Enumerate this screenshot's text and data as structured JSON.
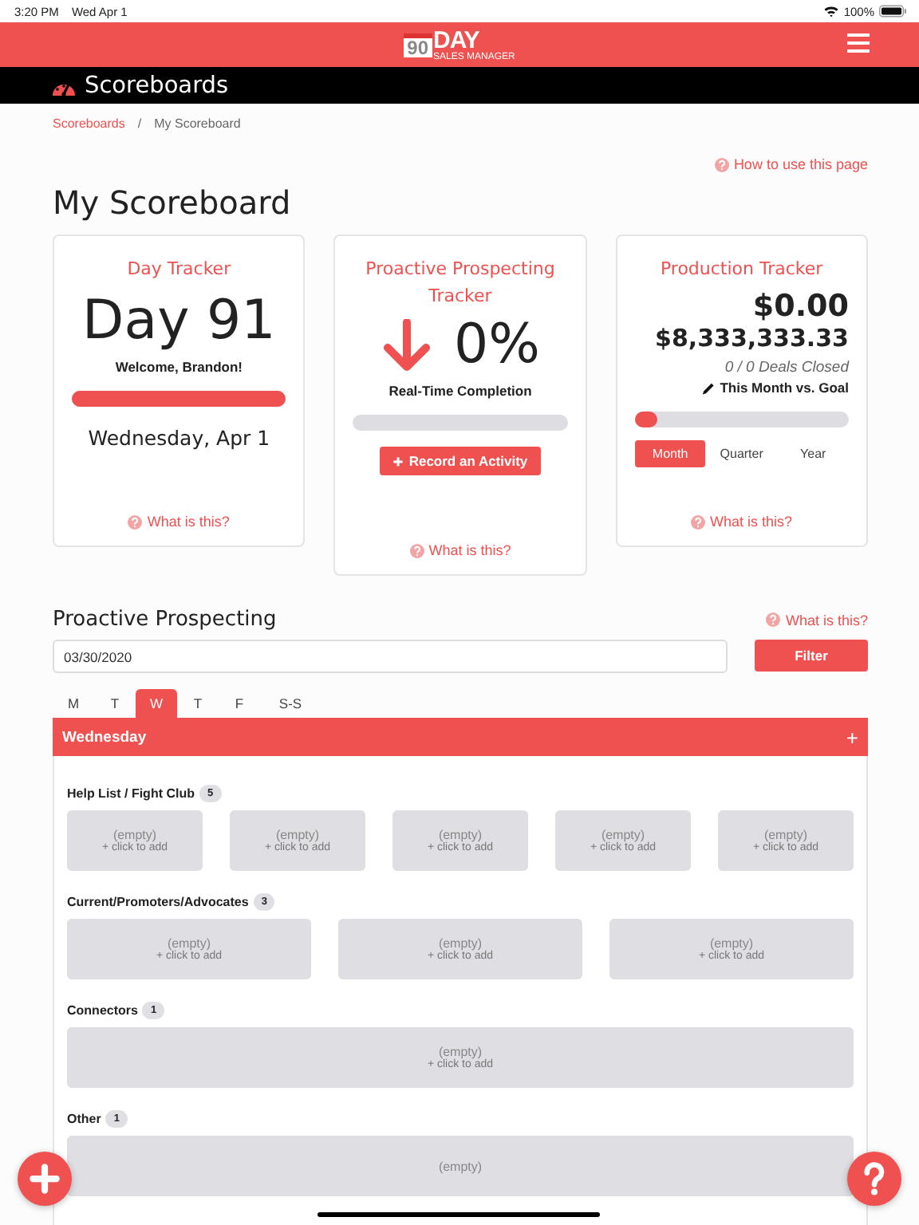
{
  "status_bar": {
    "time": "3:20 PM",
    "date": "Wed Apr 1",
    "battery": "100%"
  },
  "logo": {
    "number": "90",
    "word": "DAY",
    "tagline": "SALES MANAGER"
  },
  "page_header": {
    "title": "Scoreboards"
  },
  "breadcrumb": [
    {
      "label": "Scoreboards",
      "kind": "link"
    },
    {
      "label": "My Scoreboard",
      "kind": "current",
      "separator": "/"
    }
  ],
  "help_link": "How to use this page",
  "title": "My Scoreboard",
  "cards": [
    {
      "kind": "day",
      "title": "Day Tracker",
      "big": "Day 91",
      "welcome": "Welcome, Brandon!",
      "level": 1,
      "date": "Wednesday, Apr 1",
      "help": "What is this?"
    },
    {
      "kind": "prospecting",
      "title": "Proactive Prospecting Tracker",
      "big": "0%",
      "caption": "Real-Time Completion",
      "level": 0,
      "button": "Record an Activity",
      "help": "What is this?"
    },
    {
      "kind": "production",
      "title": "Production Tracker",
      "amount": "$0.00",
      "goal": "$8,333,333.33",
      "deals": "0 / 0 Deals Closed",
      "caption": "This Month vs. Goal",
      "level": 0,
      "periods": [
        {
          "label": "Month",
          "selected": true
        },
        {
          "label": "Quarter",
          "selected": false
        },
        {
          "label": "Year",
          "selected": false
        }
      ],
      "help": "What is this?"
    }
  ],
  "prospecting": {
    "title": "Proactive Prospecting",
    "help": "What is this?",
    "date_value": "03/30/2020",
    "filter_button": "Filter",
    "day_tabs": [
      {
        "label": "M",
        "selected": false
      },
      {
        "label": "T",
        "selected": false
      },
      {
        "label": "W",
        "selected": true
      },
      {
        "label": "T",
        "selected": false
      },
      {
        "label": "F",
        "selected": false
      },
      {
        "label": "S-S",
        "selected": false
      }
    ],
    "day_header": "Wednesday",
    "add_symbol": "+",
    "groups": [
      {
        "name": "Help List / Fight Club",
        "count": "5",
        "slots": [
          {
            "empty": "(empty)",
            "action": "+ click to add"
          },
          {
            "empty": "(empty)",
            "action": "+ click to add"
          },
          {
            "empty": "(empty)",
            "action": "+ click to add"
          },
          {
            "empty": "(empty)",
            "action": "+ click to add"
          },
          {
            "empty": "(empty)",
            "action": "+ click to add"
          }
        ]
      },
      {
        "name": "Current/Promoters/Advocates",
        "count": "3",
        "slots": [
          {
            "empty": "(empty)",
            "action": "+ click to add"
          },
          {
            "empty": "(empty)",
            "action": "+ click to add"
          },
          {
            "empty": "(empty)",
            "action": "+ click to add"
          }
        ]
      },
      {
        "name": "Connectors",
        "count": "1",
        "slots": [
          {
            "empty": "(empty)",
            "action": "+ click to add"
          }
        ]
      },
      {
        "name": "Other",
        "count": "1",
        "slots": [
          {
            "empty": "(empty)"
          }
        ]
      }
    ]
  }
}
